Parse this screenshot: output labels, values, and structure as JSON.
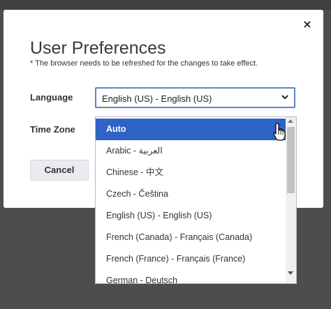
{
  "dialog": {
    "title": "User Preferences",
    "note": "* The browser needs to be refreshed for the changes to take effect.",
    "close_icon": "close-icon",
    "close_glyph": "×"
  },
  "language": {
    "label": "Language",
    "selected": "English (US) - English (US)",
    "chevron_icon": "chevron-down-icon"
  },
  "timezone": {
    "label": "Time Zone"
  },
  "buttons": {
    "cancel": "Cancel"
  },
  "dropdown": {
    "options": [
      "Auto",
      "Arabic - العربية",
      "Chinese - 中文",
      "Czech - Čeština",
      "English (US) - English (US)",
      "French (Canada) - Français (Canada)",
      "French (France) - Français (France)",
      "German - Deutsch"
    ],
    "highlighted_index": 0
  },
  "colors": {
    "accent": "#2f63c6",
    "focus_border": "#5b84cf",
    "backdrop": "#4d4d4d"
  }
}
